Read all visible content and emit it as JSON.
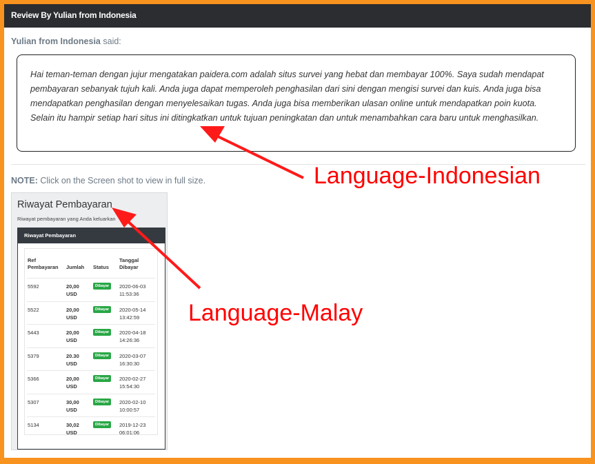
{
  "header": {
    "title": "Review By Yulian from Indonesia"
  },
  "review": {
    "author": "Yulian from Indonesia",
    "said": "said:",
    "text": "Hai teman-teman dengan jujur mengatakan paidera.com adalah situs survei yang hebat dan membayar 100%. Saya sudah mendapat pembayaran sebanyak tujuh kali. Anda juga dapat memperoleh penghasilan dari sini dengan mengisi survei dan kuis. Anda juga bisa mendapatkan penghasilan dengan menyelesaikan tugas. Anda juga bisa memberikan ulasan online untuk mendapatkan poin kuota. Selain itu hampir setiap hari situs ini ditingkatkan untuk tujuan peningkatan dan untuk menambahkan cara baru untuk menghasilkan."
  },
  "note": {
    "label": "NOTE:",
    "text": "Click on the Screen shot to view in full size."
  },
  "screenshot": {
    "title": "Riwayat Pembayaran",
    "subtitle": "Riwayat pembayaran yang Anda keluarkan",
    "card_title": "Riwayat Pembayaran",
    "columns": [
      "Ref Pembayaran",
      "Jumlah",
      "Status",
      "Tanggal Dibayar"
    ],
    "rows": [
      {
        "ref": "5592",
        "amount": "20,00",
        "currency": "USD",
        "status": "Dibayar",
        "date": "2020-06-03",
        "time": "11:53:36"
      },
      {
        "ref": "5522",
        "amount": "20,00",
        "currency": "USD",
        "status": "Dibayar",
        "date": "2020-05-14",
        "time": "13:42:59"
      },
      {
        "ref": "5443",
        "amount": "20,00",
        "currency": "USD",
        "status": "Dibayar",
        "date": "2020-04-18",
        "time": "14:26:36"
      },
      {
        "ref": "5379",
        "amount": "20.30",
        "currency": "USD",
        "status": "Dibayar",
        "date": "2020-03-07",
        "time": "16:30:30"
      },
      {
        "ref": "5366",
        "amount": "20,00",
        "currency": "USD",
        "status": "Dibayar",
        "date": "2020-02-27",
        "time": "15:54:30"
      },
      {
        "ref": "5307",
        "amount": "30,00",
        "currency": "USD",
        "status": "Dibayar",
        "date": "2020-02-10",
        "time": "10:00:57"
      },
      {
        "ref": "5134",
        "amount": "30,02",
        "currency": "USD",
        "status": "Dibayar",
        "date": "2019-12-23",
        "time": "06:01:06"
      }
    ]
  },
  "annotations": {
    "indonesian": "Language-Indonesian",
    "malay": "Language-Malay",
    "color": "#ff0000"
  },
  "colors": {
    "border": "#f7931e",
    "header_bg": "#2b2d31",
    "badge": "#28a745"
  }
}
